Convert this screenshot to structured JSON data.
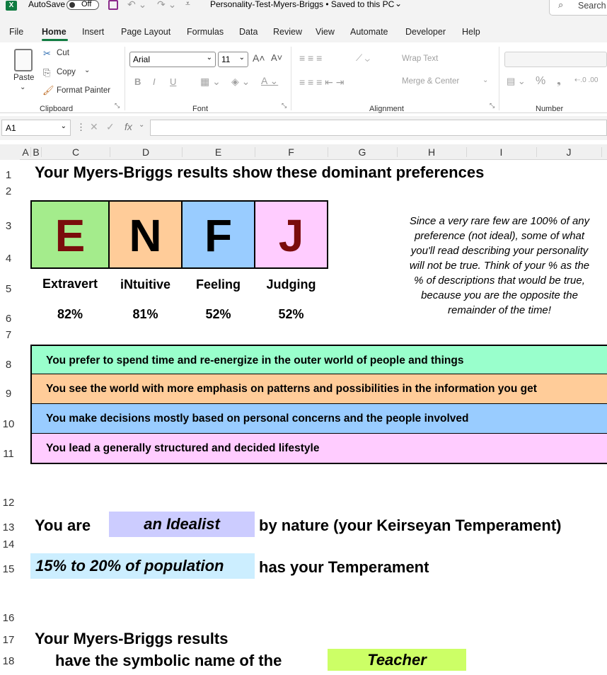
{
  "titlebar": {
    "autosave_label": "AutoSave",
    "autosave_state": "Off",
    "doc_title": "Personality-Test-Myers-Briggs • Saved to this PC",
    "search_label": "Search"
  },
  "menu": [
    "File",
    "Home",
    "Insert",
    "Page Layout",
    "Formulas",
    "Data",
    "Review",
    "View",
    "Automate",
    "Developer",
    "Help"
  ],
  "ribbon": {
    "paste": "Paste",
    "cut": "Cut",
    "copy": "Copy",
    "format_painter": "Format Painter",
    "font_name": "Arial",
    "font_size": "11",
    "bold": "B",
    "italic": "I",
    "underline": "U",
    "wrap_text": "Wrap Text",
    "merge_center": "Merge & Center",
    "groups": {
      "clipboard": "Clipboard",
      "font": "Font",
      "alignment": "Alignment",
      "number": "Number"
    }
  },
  "formula_bar": {
    "cell_ref": "A1",
    "fx": "fx"
  },
  "columns": [
    "A",
    "B",
    "C",
    "D",
    "E",
    "F",
    "G",
    "H",
    "I",
    "J"
  ],
  "rows": [
    "1",
    "2",
    "3",
    "4",
    "5",
    "6",
    "7",
    "8",
    "9",
    "10",
    "11",
    "12",
    "13",
    "14",
    "15",
    "16",
    "17",
    "18"
  ],
  "sheet": {
    "heading": "Your Myers-Briggs results show these dominant preferences",
    "letters": [
      {
        "letter": "E",
        "name": "Extravert",
        "pct": "82%",
        "bg": "#a4ec8c",
        "color": "#7a0c0c"
      },
      {
        "letter": "N",
        "name": "iNtuitive",
        "pct": "81%",
        "bg": "#ffcc99",
        "color": "#000000"
      },
      {
        "letter": "F",
        "name": "Feeling",
        "pct": "52%",
        "bg": "#99ccff",
        "color": "#000000"
      },
      {
        "letter": "J",
        "name": "Judging",
        "pct": "52%",
        "bg": "#ffccff",
        "color": "#7a0c0c"
      }
    ],
    "note": [
      "Since a very rare few are 100% of any",
      "preference (not ideal), some of what",
      "you'll read describing your personality",
      "will not be true. Think of your % as the",
      "% of descriptions that would be true,",
      "because you are the opposite the",
      "remainder of the time!"
    ],
    "statements": [
      {
        "text": "You prefer to spend time and re-energize in the outer world of people and things",
        "bg": "#99ffcc"
      },
      {
        "text": "You see the world with more emphasis on patterns and possibilities in the information you get",
        "bg": "#ffcc99"
      },
      {
        "text": "You make decisions mostly based on personal concerns and the people involved",
        "bg": "#99ccff"
      },
      {
        "text": "You lead a generally structured and decided lifestyle",
        "bg": "#ffccff"
      }
    ],
    "you_are": "You are",
    "temperament": "an Idealist",
    "by_nature": "by nature (your Keirseyan Temperament)",
    "population": "15% to 20% of population",
    "has_temperament": "has your Temperament",
    "symbolic_line1": "Your Myers-Briggs results",
    "symbolic_line2": "have the symbolic name of the",
    "symbolic_name": "Teacher"
  }
}
